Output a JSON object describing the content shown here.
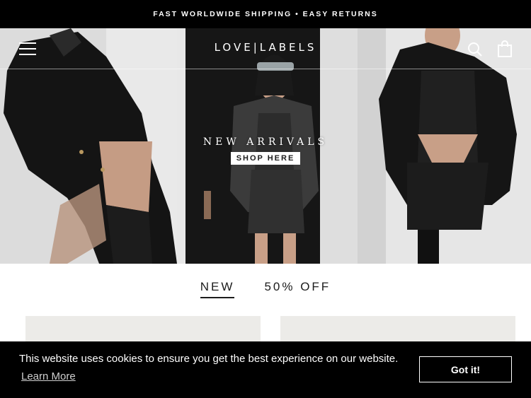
{
  "announcement": {
    "text": "FAST WORLDWIDE SHIPPING • EASY RETURNS"
  },
  "header": {
    "logo": "LOVE|LABELS"
  },
  "hero": {
    "title": "NEW ARRIVALS",
    "button": "SHOP HERE"
  },
  "tabs": [
    {
      "label": "NEW",
      "active": true
    },
    {
      "label": "50% OFF",
      "active": false
    }
  ],
  "cookie": {
    "message": "This website uses cookies to ensure you get the best experience on our website.",
    "link": "Learn More",
    "button": "Got it!"
  },
  "icons": {
    "menu": "hamburger-menu-icon",
    "search": "search-icon",
    "cart": "shopping-bag-icon"
  },
  "colors": {
    "announcement_bg": "#000000",
    "cookie_bg": "#000000",
    "card_bg": "#ecebe8"
  }
}
